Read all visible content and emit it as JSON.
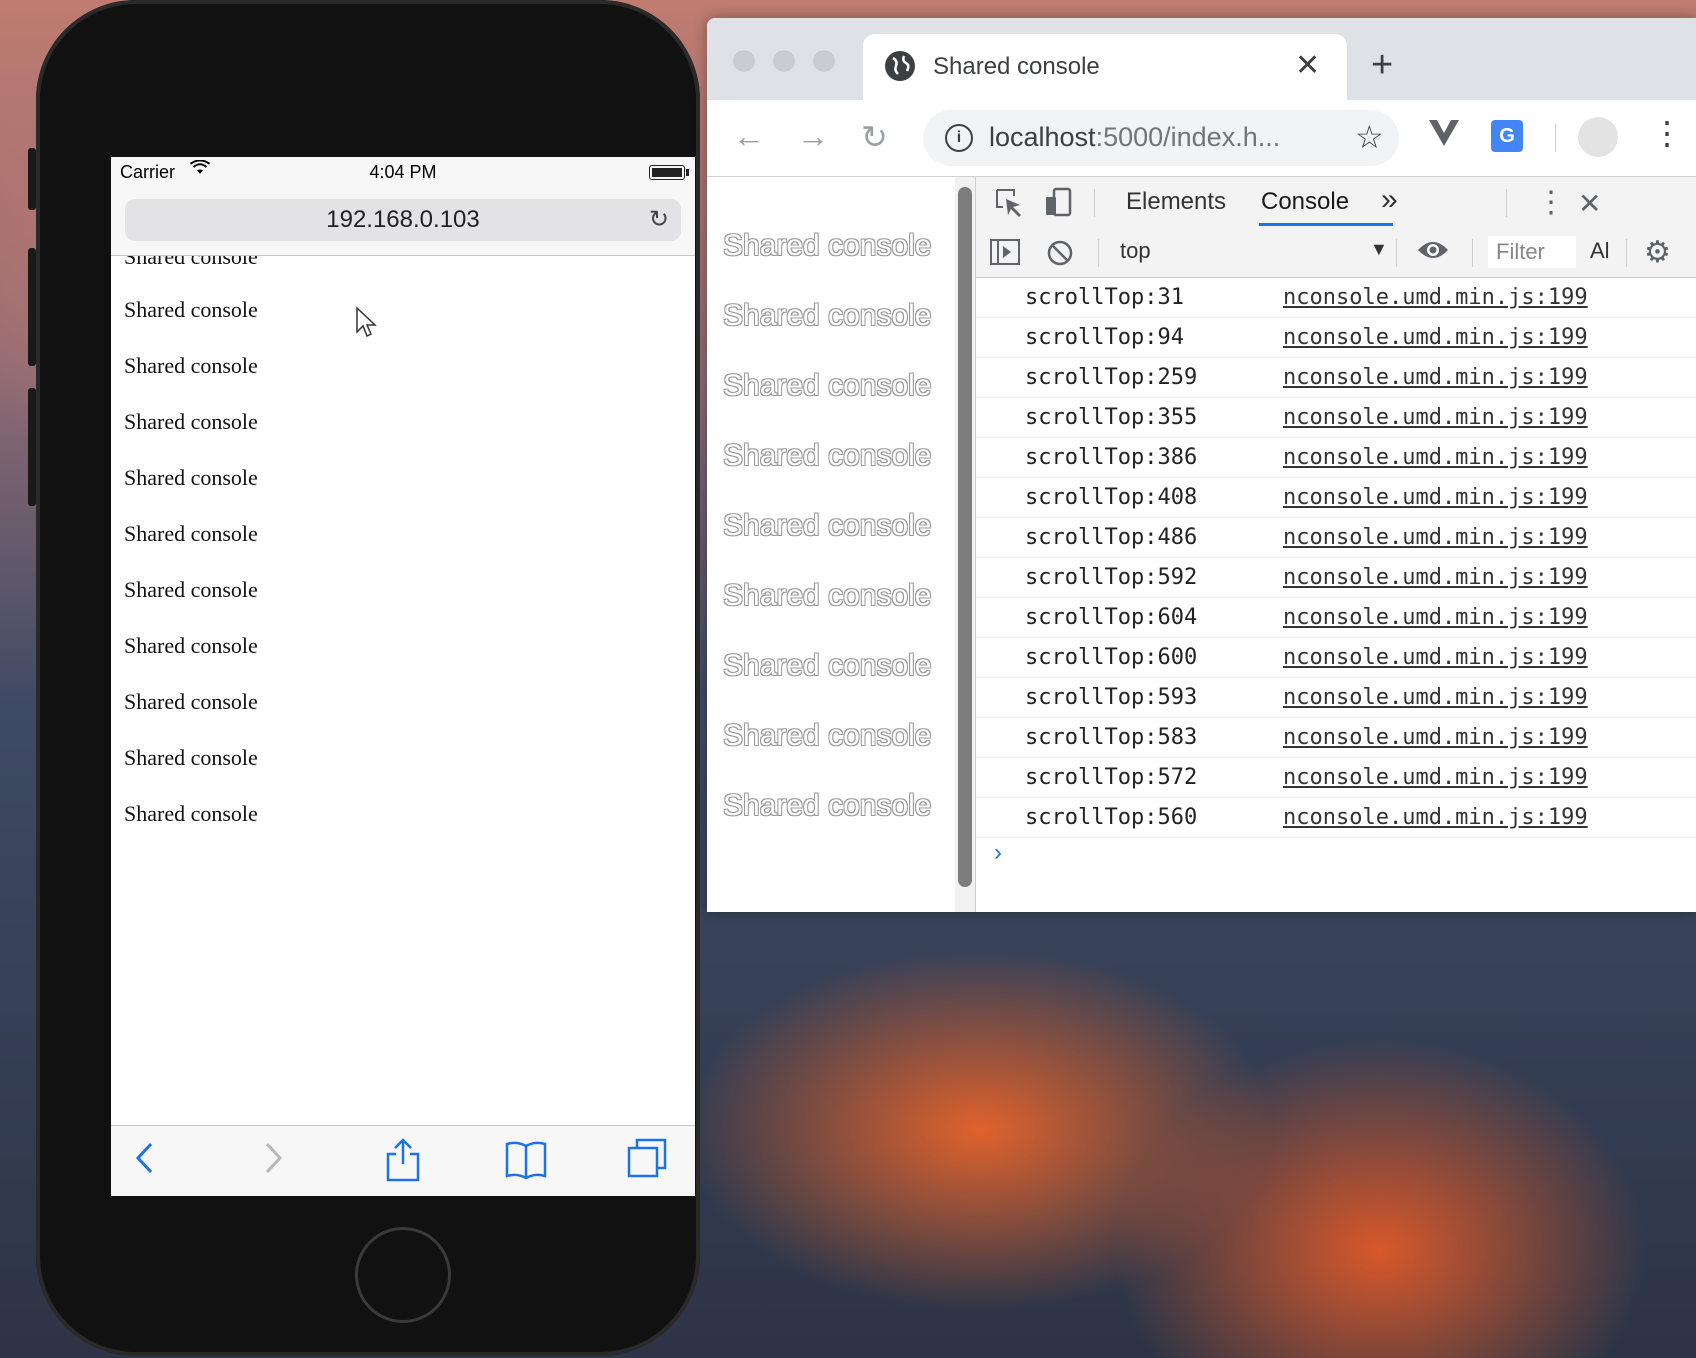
{
  "phone": {
    "carrier": "Carrier",
    "time": "4:04 PM",
    "address": "192.168.0.103",
    "lines": [
      "Shared console",
      "Shared console",
      "Shared console",
      "Shared console",
      "Shared console",
      "Shared console",
      "Shared console",
      "Shared console",
      "Shared console",
      "Shared console",
      "Shared console"
    ]
  },
  "chrome": {
    "tab_title": "Shared console",
    "url_host": "localhost",
    "url_rest": ":5000/index.h...",
    "page_lines": [
      "Shared console",
      "Shared console",
      "Shared console",
      "Shared console",
      "Shared console",
      "Shared console",
      "Shared console",
      "Shared console",
      "Shared console"
    ],
    "devtools": {
      "tabs": {
        "elements": "Elements",
        "console": "Console",
        "more": "»"
      },
      "context": "top",
      "filter_placeholder": "Filter",
      "levels": "Al",
      "logs": [
        {
          "msg": "scrollTop:31",
          "src": "nconsole.umd.min.js:199"
        },
        {
          "msg": "scrollTop:94",
          "src": "nconsole.umd.min.js:199"
        },
        {
          "msg": "scrollTop:259",
          "src": "nconsole.umd.min.js:199"
        },
        {
          "msg": "scrollTop:355",
          "src": "nconsole.umd.min.js:199"
        },
        {
          "msg": "scrollTop:386",
          "src": "nconsole.umd.min.js:199"
        },
        {
          "msg": "scrollTop:408",
          "src": "nconsole.umd.min.js:199"
        },
        {
          "msg": "scrollTop:486",
          "src": "nconsole.umd.min.js:199"
        },
        {
          "msg": "scrollTop:592",
          "src": "nconsole.umd.min.js:199"
        },
        {
          "msg": "scrollTop:604",
          "src": "nconsole.umd.min.js:199"
        },
        {
          "msg": "scrollTop:600",
          "src": "nconsole.umd.min.js:199"
        },
        {
          "msg": "scrollTop:593",
          "src": "nconsole.umd.min.js:199"
        },
        {
          "msg": "scrollTop:583",
          "src": "nconsole.umd.min.js:199"
        },
        {
          "msg": "scrollTop:572",
          "src": "nconsole.umd.min.js:199"
        },
        {
          "msg": "scrollTop:560",
          "src": "nconsole.umd.min.js:199"
        }
      ]
    }
  }
}
